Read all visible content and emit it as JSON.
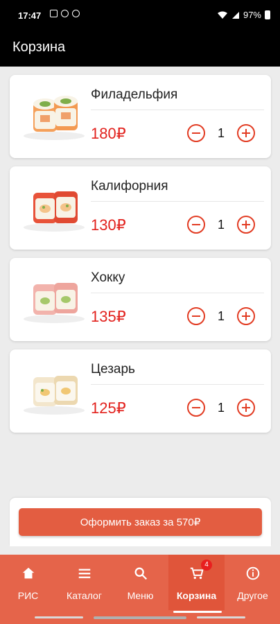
{
  "status_bar": {
    "time": "17:47",
    "battery": "97%"
  },
  "app_bar": {
    "title": "Корзина"
  },
  "cart_items": [
    {
      "name": "Филадельфия",
      "price": "180₽",
      "quantity": "1"
    },
    {
      "name": "Калифорния",
      "price": "130₽",
      "quantity": "1"
    },
    {
      "name": "Хокку",
      "price": "135₽",
      "quantity": "1"
    },
    {
      "name": "Цезарь",
      "price": "125₽",
      "quantity": "1"
    }
  ],
  "checkout": {
    "label": "Оформить заказ за 570₽"
  },
  "bottom_nav": {
    "items": [
      {
        "label": "РИС",
        "icon": "home-icon"
      },
      {
        "label": "Каталог",
        "icon": "menu-lines-icon"
      },
      {
        "label": "Меню",
        "icon": "search-icon"
      },
      {
        "label": "Корзина",
        "icon": "cart-icon",
        "badge": "4",
        "active": true
      },
      {
        "label": "Другое",
        "icon": "info-icon"
      }
    ]
  },
  "colors": {
    "accent": "#e5644a",
    "price": "#e2221e",
    "button": "#e35d41"
  }
}
